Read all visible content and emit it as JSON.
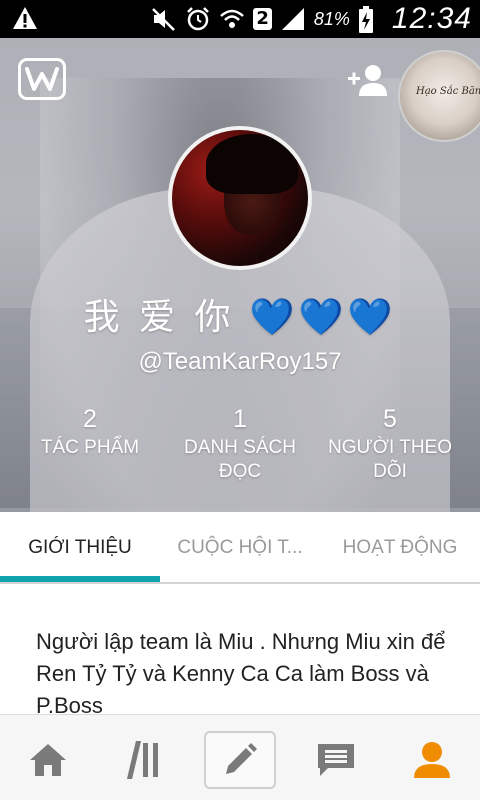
{
  "status_bar": {
    "sim_slot": "2",
    "battery": "81%",
    "time": "12:34"
  },
  "profile": {
    "display_name": "我 爱 你 💙💙💙",
    "username": "@TeamKarRoy157",
    "small_avatar_text": "Hạo Sắc Băng"
  },
  "stats": [
    {
      "value": "2",
      "label": "TÁC PHẨM"
    },
    {
      "value": "1",
      "label": "DANH SÁCH ĐỌC"
    },
    {
      "value": "5",
      "label": "NGƯỜI THEO DÕI"
    }
  ],
  "tabs": [
    {
      "label": "GIỚI THIỆU"
    },
    {
      "label": "CUỘC HỘI T..."
    },
    {
      "label": "HOẠT ĐỘNG"
    }
  ],
  "about": {
    "text": "Người lập team là Miu . Nhưng Miu xin để Ren Tỷ Tỷ và Kenny Ca Ca làm Boss và P.Boss"
  },
  "colors": {
    "accent": "#0fa4ad",
    "nav_active": "#f08c00",
    "nav_inactive": "#7a7a7a"
  },
  "icons": {
    "nav": [
      "home-icon",
      "library-icon",
      "write-icon",
      "messages-icon",
      "profile-icon"
    ]
  }
}
